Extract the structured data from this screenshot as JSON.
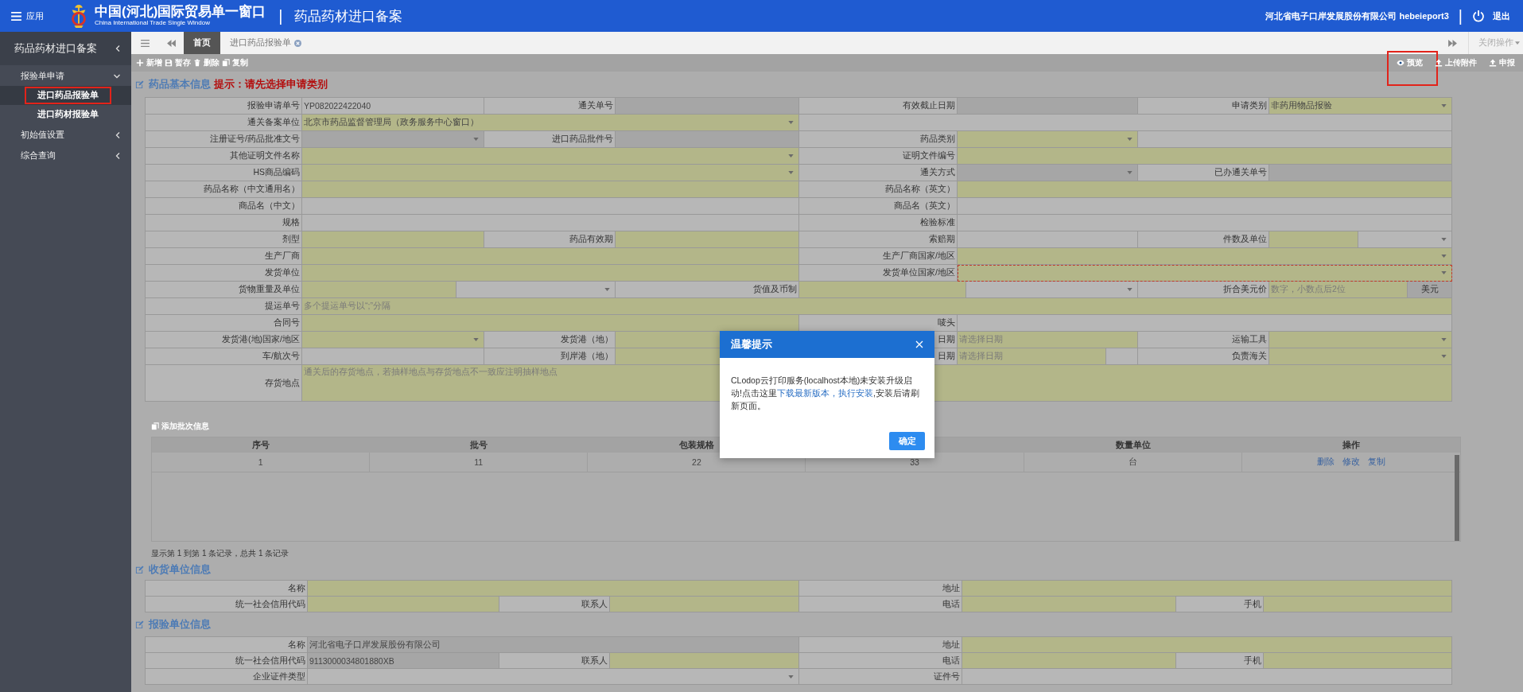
{
  "header": {
    "menu_label": "应用",
    "title": "中国(河北)国际贸易单一窗口",
    "subtitle": "China International Trade Single Window",
    "separator": "|",
    "module": "药品药材进口备案",
    "user": "河北省电子口岸发展股份有限公司 hebeieport3",
    "separator_right": "|",
    "logout": "退出"
  },
  "sidebar": {
    "title": "药品药材进口备案",
    "items": [
      {
        "label": "报验单申请",
        "expanded": true,
        "children": [
          {
            "label": "进口药品报验单",
            "selected": true,
            "highlighted": true
          },
          {
            "label": "进口药材报验单",
            "selected": false,
            "highlighted": false
          }
        ]
      },
      {
        "label": "初始值设置",
        "expanded": false
      },
      {
        "label": "综合查询",
        "expanded": false
      }
    ]
  },
  "tabs": [
    {
      "label": "首页",
      "selected": true,
      "closable": false
    },
    {
      "label": "进口药品报验单",
      "selected": false,
      "closable": true
    }
  ],
  "tab_actions": "关闭操作",
  "toolbar": {
    "left": [
      {
        "label": "新增"
      },
      {
        "label": "暂存"
      },
      {
        "label": "删除"
      },
      {
        "label": "复制"
      }
    ],
    "right": [
      {
        "label": "预览",
        "highlighted": true
      },
      {
        "label": "上传附件",
        "highlighted": false
      },
      {
        "label": "申报",
        "highlighted": false
      }
    ]
  },
  "basic_section": {
    "title": "药品基本信息",
    "hint": "提示：请先选择申请类别",
    "rows": [
      {
        "kind": "quad",
        "fields": [
          {
            "label": "报验申请单号",
            "control": {
              "kind": "input",
              "value": "YP082022422040",
              "required": false,
              "disabled": false
            }
          },
          {
            "label": "通关单号",
            "control": {
              "kind": "input",
              "required": false,
              "disabled": true
            }
          },
          {
            "label": "有效截止日期",
            "control": {
              "kind": "input",
              "required": false,
              "disabled": true
            }
          },
          {
            "label": "申请类别",
            "control": {
              "kind": "select",
              "value": "非药用物品报验",
              "required": true,
              "disabled": false
            }
          }
        ]
      },
      {
        "kind": "half",
        "fields": [
          {
            "label": "通关备案单位",
            "control": {
              "kind": "select",
              "value": "北京市药品监督管理局（政务服务中心窗口）",
              "required": true,
              "disabled": false
            }
          }
        ]
      },
      {
        "kind": "quad",
        "fields": [
          {
            "label": "注册证号/药品批准文号",
            "control": {
              "kind": "select",
              "required": false,
              "disabled": true
            }
          },
          {
            "label": "进口药品批件号",
            "control": {
              "kind": "input",
              "required": false,
              "disabled": true
            }
          },
          {
            "label": "药品类别",
            "control": {
              "kind": "select",
              "required": true,
              "disabled": false
            }
          }
        ]
      },
      {
        "kind": "half",
        "fields": [
          {
            "label": "其他证明文件名称",
            "control": {
              "kind": "select",
              "required": true,
              "disabled": false
            }
          },
          {
            "label": "证明文件编号",
            "control": {
              "kind": "input",
              "required": true,
              "disabled": false
            }
          }
        ]
      },
      {
        "kind": "half_quad",
        "fields": [
          {
            "label": "HS商品编码",
            "control": {
              "kind": "select",
              "required": true,
              "disabled": false
            }
          },
          {
            "label": "通关方式",
            "control": {
              "kind": "select",
              "required": false,
              "disabled": true
            }
          },
          {
            "label": "已办通关单号",
            "control": {
              "kind": "input",
              "required": false,
              "disabled": true
            }
          }
        ]
      },
      {
        "kind": "half",
        "fields": [
          {
            "label": "药品名称（中文通用名）",
            "control": {
              "kind": "input",
              "required": true,
              "disabled": false
            }
          },
          {
            "label": "药品名称（英文）",
            "control": {
              "kind": "input",
              "required": true,
              "disabled": false
            }
          }
        ]
      },
      {
        "kind": "half",
        "fields": [
          {
            "label": "商品名（中文）",
            "control": {
              "kind": "input",
              "required": false,
              "disabled": false
            }
          },
          {
            "label": "商品名（英文）",
            "control": {
              "kind": "input",
              "required": false,
              "disabled": false
            }
          }
        ]
      },
      {
        "kind": "half",
        "fields": [
          {
            "label": "规格",
            "control": {
              "kind": "input",
              "required": false,
              "disabled": false
            }
          },
          {
            "label": "检验标准",
            "control": {
              "kind": "input",
              "required": false,
              "disabled": false
            }
          }
        ]
      },
      {
        "kind": "quad",
        "fields": [
          {
            "label": "剂型",
            "control": {
              "kind": "input",
              "required": true,
              "disabled": false
            }
          },
          {
            "label": "药品有效期",
            "control": {
              "kind": "input",
              "required": true,
              "disabled": false
            }
          },
          {
            "label": "索赔期",
            "control": {
              "kind": "input",
              "required": false,
              "disabled": false
            }
          },
          {
            "label": "件数及单位",
            "control": {
              "kind": "group",
              "parts": [
                {
                  "kind": "input",
                  "required": true,
                  "disabled": false
                },
                {
                  "kind": "select",
                  "required": false,
                  "disabled": false
                }
              ]
            }
          }
        ]
      },
      {
        "kind": "half",
        "fields": [
          {
            "label": "生产厂商",
            "control": {
              "kind": "input",
              "required": true,
              "disabled": false
            }
          },
          {
            "label": "生产厂商国家/地区",
            "control": {
              "kind": "select",
              "required": true,
              "disabled": false
            }
          }
        ]
      },
      {
        "kind": "half",
        "fields": [
          {
            "label": "发货单位",
            "control": {
              "kind": "input",
              "required": true,
              "disabled": false
            }
          },
          {
            "label": "发货单位国家/地区",
            "control": {
              "kind": "select",
              "required": true,
              "disabled": false,
              "invalid": true
            }
          }
        ]
      },
      {
        "kind": "triple",
        "fields": [
          {
            "label": "货物重量及单位",
            "control": {
              "kind": "group",
              "parts": [
                {
                  "kind": "input",
                  "required": true,
                  "disabled": false
                },
                {
                  "kind": "select",
                  "required": false,
                  "disabled": false
                }
              ]
            }
          },
          {
            "label": "货值及币制",
            "control": {
              "kind": "group",
              "parts": [
                {
                  "kind": "input",
                  "required": true,
                  "disabled": false
                },
                {
                  "kind": "select",
                  "required": false,
                  "disabled": false
                }
              ]
            }
          },
          {
            "label": "折合美元价",
            "control": {
              "kind": "group",
              "parts": [
                {
                  "kind": "input",
                  "placeholder": "数字，小数点后2位",
                  "required": true,
                  "disabled": false
                },
                {
                  "kind": "unit",
                  "text": "美元"
                }
              ]
            }
          }
        ]
      },
      {
        "kind": "full",
        "fields": [
          {
            "label": "提运单号",
            "control": {
              "kind": "input",
              "placeholder": "多个提运单号以“;”分隔",
              "required": true,
              "disabled": false
            }
          }
        ]
      },
      {
        "kind": "half",
        "fields": [
          {
            "label": "合同号",
            "control": {
              "kind": "input",
              "required": true,
              "disabled": false
            }
          },
          {
            "label": "唛头",
            "control": {
              "kind": "input",
              "required": false,
              "disabled": false
            }
          }
        ]
      },
      {
        "kind": "quad",
        "fields": [
          {
            "label": "发货港(地)国家/地区",
            "control": {
              "kind": "select",
              "required": true,
              "disabled": false
            }
          },
          {
            "label": "发货港（地）",
            "control": {
              "kind": "input",
              "required": true,
              "disabled": false
            }
          },
          {
            "label": "日期",
            "control": {
              "kind": "input",
              "placeholder": "请选择日期",
              "required": true,
              "disabled": false
            }
          },
          {
            "label": "运输工具",
            "control": {
              "kind": "select",
              "required": true,
              "disabled": false
            }
          }
        ]
      },
      {
        "kind": "quad",
        "fields": [
          {
            "label": "车/航次号",
            "control": {
              "kind": "input",
              "required": false,
              "disabled": false
            }
          },
          {
            "label": "到岸港（地）",
            "control": {
              "kind": "input",
              "required": true,
              "disabled": false
            }
          },
          {
            "label": "日期",
            "control": {
              "kind": "group",
              "parts": [
                {
                  "kind": "input",
                  "placeholder": "请选择日期",
                  "required": true,
                  "disabled": false
                },
                {
                  "kind": "input",
                  "required": false,
                  "disabled": false
                }
              ]
            }
          },
          {
            "label": "负责海关",
            "control": {
              "kind": "select",
              "required": true,
              "disabled": false
            }
          }
        ]
      },
      {
        "kind": "full",
        "fields": [
          {
            "label": "存货地点",
            "control": {
              "kind": "textarea",
              "placeholder": "通关后的存货地点，若抽样地点与存货地点不一致应注明抽样地点",
              "required": true,
              "disabled": false
            }
          }
        ]
      }
    ]
  },
  "batch": {
    "add_button": "添加批次信息",
    "columns": [
      {
        "label": "序号"
      },
      {
        "label": "批号"
      },
      {
        "label": "包装规格"
      },
      {},
      {
        "label": "数量单位"
      },
      {
        "label": "操作"
      }
    ],
    "rows": [
      {
        "cells": [
          "1",
          "11",
          "22",
          "33",
          "台"
        ],
        "actions": [
          "删除",
          "修改",
          "复制"
        ]
      }
    ],
    "footer": "显示第 1 到第 1 条记录，总共 1 条记录"
  },
  "consignee_section": {
    "title": "收货单位信息",
    "rows": [
      {
        "kind": "half",
        "fields": [
          {
            "label": "名称",
            "control": {
              "kind": "input",
              "required": true,
              "disabled": false
            }
          },
          {
            "label": "地址",
            "control": {
              "kind": "input",
              "required": true,
              "disabled": false
            }
          }
        ]
      },
      {
        "kind": "quad",
        "fields": [
          {
            "label": "统一社会信用代码",
            "control": {
              "kind": "input",
              "required": true,
              "disabled": false
            }
          },
          {
            "label": "联系人",
            "control": {
              "kind": "input",
              "required": true,
              "disabled": false
            }
          },
          {
            "label": "电话",
            "control": {
              "kind": "input",
              "required": true,
              "disabled": false
            }
          },
          {
            "label": "手机",
            "control": {
              "kind": "input",
              "required": true,
              "disabled": false
            }
          }
        ]
      }
    ]
  },
  "inspector_section": {
    "title": "报验单位信息",
    "rows": [
      {
        "kind": "half",
        "fields": [
          {
            "label": "名称",
            "control": {
              "kind": "input",
              "value": "河北省电子口岸发展股份有限公司",
              "required": false,
              "disabled": true
            }
          },
          {
            "label": "地址",
            "control": {
              "kind": "input",
              "required": true,
              "disabled": false
            }
          }
        ]
      },
      {
        "kind": "quad",
        "fields": [
          {
            "label": "统一社会信用代码",
            "control": {
              "kind": "input",
              "value": "9113000034801880XB",
              "required": false,
              "disabled": true
            }
          },
          {
            "label": "联系人",
            "control": {
              "kind": "input",
              "required": true,
              "disabled": false
            }
          },
          {
            "label": "电话",
            "control": {
              "kind": "input",
              "required": true,
              "disabled": false
            }
          },
          {
            "label": "手机",
            "control": {
              "kind": "input",
              "required": true,
              "disabled": false
            }
          }
        ]
      },
      {
        "kind": "half",
        "fields": [
          {
            "label": "企业证件类型",
            "control": {
              "kind": "select",
              "required": false,
              "disabled": false
            }
          },
          {
            "label": "证件号",
            "control": {
              "kind": "input",
              "required": false,
              "disabled": false
            }
          }
        ]
      }
    ]
  },
  "dialog": {
    "title": "温馨提示",
    "message_before": "CLodop云打印服务(localhost本地)未安装升级启动!点击这里",
    "link": "下载最新版本，执行安装",
    "message_after": ",安装后请刷新页面。",
    "button": "确定"
  }
}
